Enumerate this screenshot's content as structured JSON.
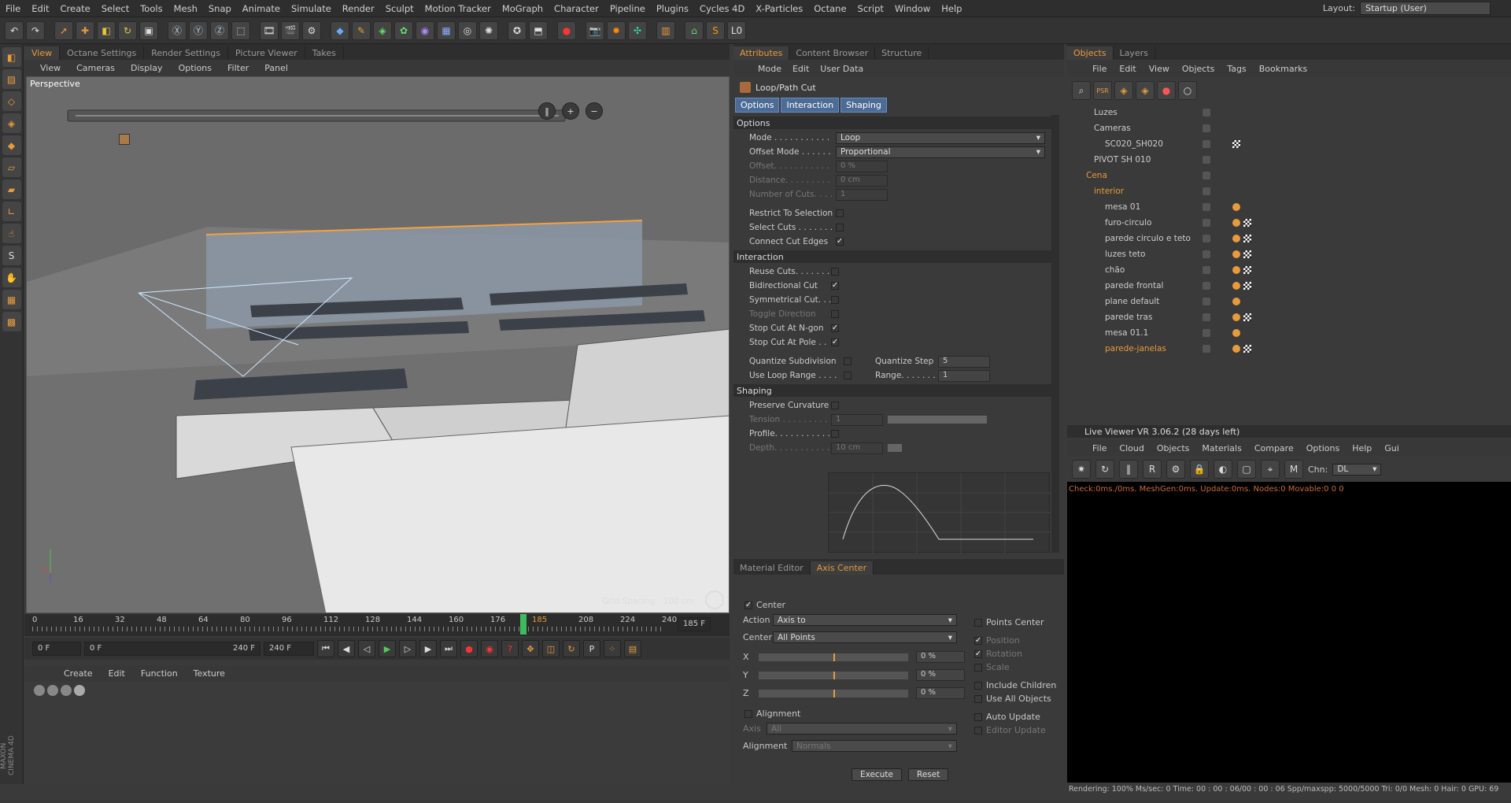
{
  "menubar": {
    "items": [
      "File",
      "Edit",
      "Create",
      "Select",
      "Tools",
      "Mesh",
      "Snap",
      "Animate",
      "Simulate",
      "Render",
      "Sculpt",
      "Motion Tracker",
      "MoGraph",
      "Character",
      "Pipeline",
      "Plugins",
      "Cycles 4D",
      "X-Particles",
      "Octane",
      "Script",
      "Window",
      "Help"
    ],
    "layout_label": "Layout:",
    "layout_value": "Startup (User)"
  },
  "viewport": {
    "tabs": [
      "View",
      "Octane Settings",
      "Render Settings",
      "Picture Viewer",
      "Takes"
    ],
    "menu": [
      "View",
      "Cameras",
      "Display",
      "Options",
      "Filter",
      "Panel"
    ],
    "label": "Perspective",
    "grid_spacing": "Grid Spacing : 100 cm"
  },
  "timeline": {
    "ticks": [
      "0",
      "16",
      "32",
      "48",
      "64",
      "80",
      "96",
      "112",
      "128",
      "144",
      "160",
      "176",
      "185",
      "208",
      "224",
      "240"
    ],
    "current_frame_label": "185 F",
    "start": "0 F",
    "range_start": "0 F",
    "range_end": "240 F",
    "end": "240 F"
  },
  "material": {
    "menu": [
      "Create",
      "Edit",
      "Function",
      "Texture"
    ]
  },
  "attributes": {
    "tabs": [
      "Attributes",
      "Content Browser",
      "Structure"
    ],
    "menu": [
      "Mode",
      "Edit",
      "User Data"
    ],
    "title": "Loop/Path Cut",
    "subtabs": [
      "Options",
      "Interaction",
      "Shaping"
    ],
    "options_header": "Options",
    "mode_label": "Mode . . . . . . . . . . .",
    "mode_value": "Loop",
    "offset_mode_label": "Offset Mode . . . . . .",
    "offset_mode_value": "Proportional",
    "offset_label": "Offset. . . . . . . . . . .",
    "offset_value": "0 %",
    "distance_label": "Distance. . . . . . . . .",
    "distance_value": "0 cm",
    "cuts_label": "Number of Cuts. . . .",
    "cuts_value": "1",
    "restrict_label": "Restrict To Selection",
    "select_cuts_label": "Select Cuts . . . . . . .",
    "connect_label": "Connect Cut Edges",
    "interaction_header": "Interaction",
    "reuse_label": "Reuse Cuts. . . . . . . .",
    "bidir_label": "Bidirectional Cut",
    "sym_label": "Symmetrical Cut. . .",
    "toggle_label": "Toggle Direction",
    "ngon_label": "Stop Cut At N-gon",
    "pole_label": "Stop Cut At Pole . .",
    "quant_sub_label": "Quantize Subdivision",
    "quant_step_label": "Quantize Step",
    "quant_step_value": "5",
    "loop_range_label": "Use Loop Range . . . .",
    "range_label": "Range. . . . . . . .",
    "range_value": "1",
    "shaping_header": "Shaping",
    "preserve_label": "Preserve Curvature",
    "tension_label": "Tension . . . . . . . . .",
    "tension_value": "1",
    "profile_label": "Profile. . . . . . . . . . .",
    "depth_label": "Depth. . . . . . . . . . .",
    "depth_value": "10 cm"
  },
  "axis": {
    "tabs": [
      "Material Editor",
      "Axis Center"
    ],
    "center_label": "Center",
    "action_label": "Action",
    "action_value": "Axis to",
    "center2_label": "Center",
    "center2_value": "All Points",
    "x_label": "X",
    "y_label": "Y",
    "z_label": "Z",
    "x_value": "0 %",
    "y_value": "0 %",
    "z_value": "0 %",
    "points_center": "Points Center",
    "position": "Position",
    "rotation": "Rotation",
    "scale": "Scale",
    "include_children": "Include Children",
    "use_all": "Use All Objects",
    "auto_update": "Auto Update",
    "editor_update": "Editor Update",
    "alignment_label": "Alignment",
    "axis_label": "Axis",
    "axis_value": "All",
    "alignment2_label": "Alignment",
    "alignment2_value": "Normals",
    "execute": "Execute",
    "reset": "Reset"
  },
  "objects": {
    "tabs": [
      "Objects",
      "Layers"
    ],
    "menu": [
      "File",
      "Edit",
      "View",
      "Objects",
      "Tags",
      "Bookmarks"
    ],
    "items": [
      {
        "name": "Luzes",
        "indent": 1,
        "color": "#ccc"
      },
      {
        "name": "Cameras",
        "indent": 1,
        "color": "#ccc"
      },
      {
        "name": "SC020_SH020",
        "indent": 2,
        "color": "#ccc"
      },
      {
        "name": "PIVOT SH 010",
        "indent": 1,
        "color": "#ccc"
      },
      {
        "name": "Cena",
        "indent": 0,
        "color": "#e89a3c"
      },
      {
        "name": "interior",
        "indent": 1,
        "color": "#e89a3c"
      },
      {
        "name": "mesa 01",
        "indent": 2,
        "color": "#ccc"
      },
      {
        "name": "furo-circulo",
        "indent": 2,
        "color": "#ccc"
      },
      {
        "name": "parede circulo e teto",
        "indent": 2,
        "color": "#ccc"
      },
      {
        "name": "luzes teto",
        "indent": 2,
        "color": "#ccc"
      },
      {
        "name": "chão",
        "indent": 2,
        "color": "#ccc"
      },
      {
        "name": "parede frontal",
        "indent": 2,
        "color": "#ccc"
      },
      {
        "name": "plane default",
        "indent": 2,
        "color": "#ccc"
      },
      {
        "name": "parede tras",
        "indent": 2,
        "color": "#ccc"
      },
      {
        "name": "mesa 01.1",
        "indent": 2,
        "color": "#ccc"
      },
      {
        "name": "parede-janelas",
        "indent": 2,
        "color": "#e89a3c"
      }
    ]
  },
  "liveviewer": {
    "title": "Live Viewer VR 3.06.2 (28 days left)",
    "menu": [
      "File",
      "Cloud",
      "Objects",
      "Materials",
      "Compare",
      "Options",
      "Help",
      "Gui"
    ],
    "chn_label": "Chn:",
    "chn_value": "DL",
    "status": "Check:0ms./0ms. MeshGen:0ms. Update:0ms. Nodes:0 Movable:0  0 0",
    "footer": "Rendering: 100%  Ms/sec: 0   Time: 00 : 00 : 06/00 : 00 : 06  Spp/maxspp: 5000/5000   Tri: 0/0   Mesh: 0  Hair: 0    GPU: 69"
  },
  "brand": "MAXON CINEMA 4D"
}
